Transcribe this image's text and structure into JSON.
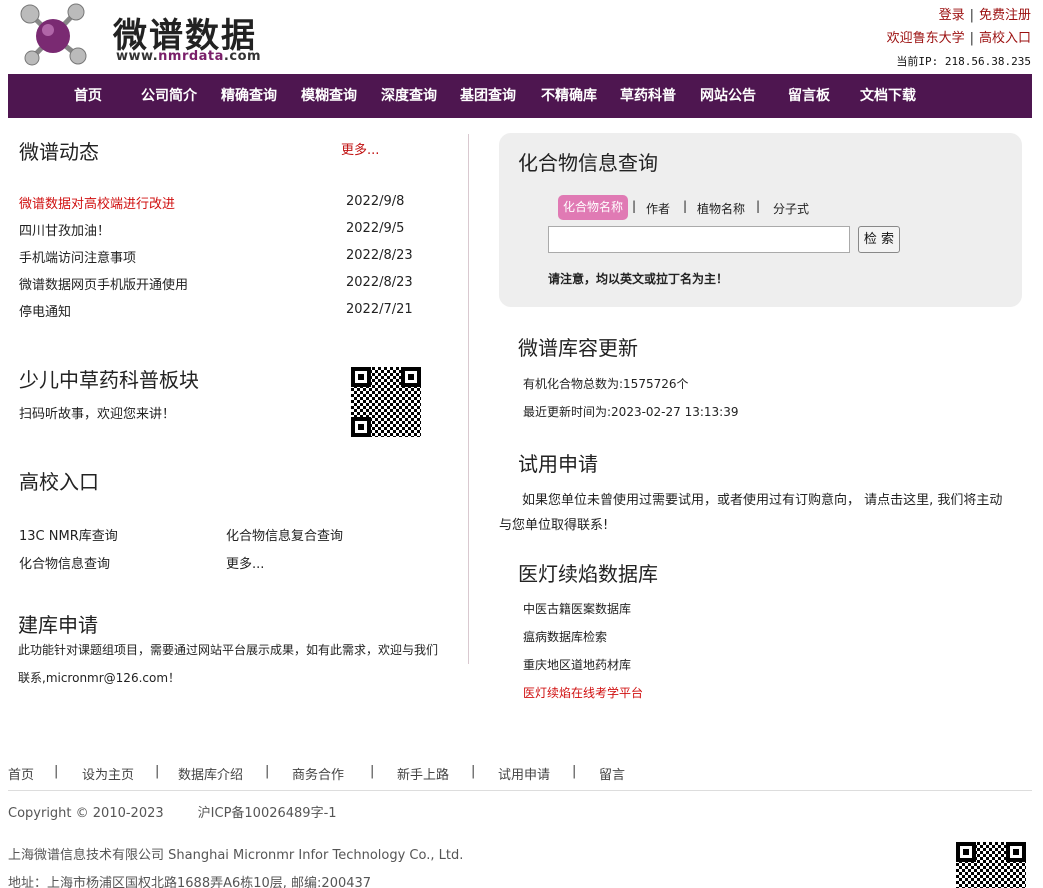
{
  "header": {
    "logo_title": "微谱数据",
    "logo_url_prefix": "www.",
    "logo_url_highlight": "nmrdata",
    "logo_url_suffix": ".com",
    "login": "登录",
    "register": "免费注册",
    "welcome": "欢迎鲁东大学",
    "campus": "高校入口",
    "ip_label": "当前IP:",
    "ip_value": "218.56.38.235"
  },
  "nav": [
    "首页",
    "公司简介",
    "精确查询",
    "模糊查询",
    "深度查询",
    "基团查询",
    "不精确库",
    "草药科普",
    "网站公告",
    "留言板",
    "文档下载"
  ],
  "news": {
    "title": "微谱动态",
    "more": "更多...",
    "items": [
      {
        "title": "微谱数据对高校端进行改进",
        "date": "2022/9/8"
      },
      {
        "title": "四川甘孜加油！",
        "date": "2022/9/5"
      },
      {
        "title": "手机端访问注意事项",
        "date": "2022/8/23"
      },
      {
        "title": "微谱数据网页手机版开通使用",
        "date": "2022/8/23"
      },
      {
        "title": "停电通知",
        "date": "2022/7/21"
      }
    ]
  },
  "herbal": {
    "title": "少儿中草药科普板块",
    "desc": "扫码听故事，欢迎您来讲！"
  },
  "campus_entry": {
    "title": "高校入口",
    "links": [
      "13C NMR库查询",
      "化合物信息复合查询",
      "化合物信息查询",
      "更多..."
    ]
  },
  "build_db": {
    "title": "建库申请",
    "line1": "此功能针对课题组项目，需要通过网站平台展示成果，如有此需求，欢迎与我们",
    "line2": "联系,micronmr@126.com！"
  },
  "search": {
    "title": "化合物信息查询",
    "tabs": [
      "化合物名称",
      "作者",
      "植物名称",
      "分子式"
    ],
    "input_value": "",
    "button": "检 索",
    "notice": "请注意，均以英文或拉丁名为主！"
  },
  "update": {
    "title": "微谱库容更新",
    "count": "有机化合物总数为:1575726个",
    "time": "最近更新时间为:2023-02-27 13:13:39"
  },
  "trial": {
    "title": "试用申请",
    "line1": "如果您单位未曾使用过需要试用，或者使用过有订购意向， 请点击这里, 我们将主动",
    "line2": "与您单位取得联系!"
  },
  "yideng": {
    "title": "医灯续焰数据库",
    "links": [
      "中医古籍医案数据库",
      "瘟病数据库检索",
      "重庆地区道地药材库",
      "医灯续焰在线考学平台"
    ]
  },
  "footer": {
    "links": [
      "首页",
      "|",
      "设为主页",
      "|",
      "数据库介绍",
      "|",
      "商务合作",
      "|",
      "新手上路",
      "|",
      "试用申请",
      "|",
      "留言"
    ],
    "copyright": "Copyright © 2010-2023",
    "icp": "沪ICP备10026489字-1",
    "company": "上海微谱信息技术有限公司 Shanghai Micronmr Infor Technology Co., Ltd.",
    "address": "地址：上海市杨浦区国权北路1688弄A6栋10层, 邮编:200437"
  },
  "colors": {
    "nav_bg": "#4e1650",
    "accent_red": "#c01010",
    "tab_active": "#e07ab4"
  }
}
